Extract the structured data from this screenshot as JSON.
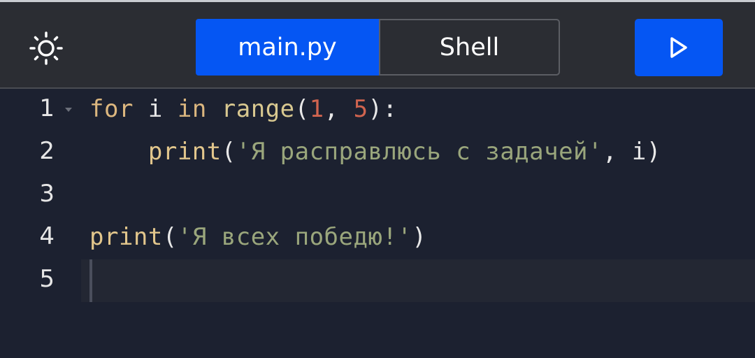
{
  "header": {
    "theme_toggle_icon": "sun-icon",
    "tabs": [
      {
        "label": "main.py",
        "active": true
      },
      {
        "label": "Shell",
        "active": false
      }
    ],
    "run_button_icon": "play-icon"
  },
  "colors": {
    "accent": "#0556f3",
    "header_bg": "#2b2d33",
    "editor_bg": "#1c2130",
    "current_line_bg": "#232733",
    "keyword": "#dcb77f",
    "string": "#9aa67c",
    "number": "#d0644f",
    "text": "#e8e8e8"
  },
  "editor": {
    "lines": [
      {
        "number": "1",
        "foldable": true,
        "tokens": [
          {
            "text": "for",
            "type": "kw"
          },
          {
            "text": " i ",
            "type": "plain"
          },
          {
            "text": "in",
            "type": "kw"
          },
          {
            "text": " ",
            "type": "plain"
          },
          {
            "text": "range",
            "type": "fn"
          },
          {
            "text": "(",
            "type": "plain"
          },
          {
            "text": "1",
            "type": "num"
          },
          {
            "text": ", ",
            "type": "plain"
          },
          {
            "text": "5",
            "type": "num"
          },
          {
            "text": "):",
            "type": "plain"
          }
        ]
      },
      {
        "number": "2",
        "foldable": false,
        "tokens": [
          {
            "text": "    ",
            "type": "plain"
          },
          {
            "text": "print",
            "type": "builtin"
          },
          {
            "text": "(",
            "type": "plain"
          },
          {
            "text": "'Я расправлюсь с задачей'",
            "type": "str"
          },
          {
            "text": ", i)",
            "type": "plain"
          }
        ]
      },
      {
        "number": "3",
        "foldable": false,
        "tokens": []
      },
      {
        "number": "4",
        "foldable": false,
        "tokens": [
          {
            "text": "print",
            "type": "builtin"
          },
          {
            "text": "(",
            "type": "plain"
          },
          {
            "text": "'Я всех победю!'",
            "type": "str"
          },
          {
            "text": ")",
            "type": "plain"
          }
        ]
      },
      {
        "number": "5",
        "foldable": false,
        "current": true,
        "tokens": []
      }
    ]
  }
}
